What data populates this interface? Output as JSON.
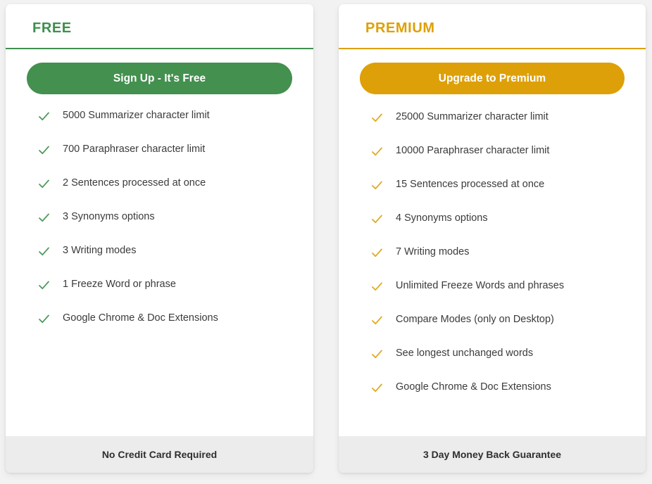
{
  "plans": [
    {
      "id": "free",
      "title": "FREE",
      "accent_color": "#3f8f4f",
      "button_color": "#43904f",
      "cta_label": "Sign Up - It's Free",
      "check_icon": "check-icon",
      "features": [
        "5000 Summarizer character limit",
        "700 Paraphraser character limit",
        "2 Sentences processed at once",
        "3 Synonyms options",
        "3 Writing modes",
        "1 Freeze Word or phrase",
        "Google Chrome & Doc Extensions"
      ],
      "footer_note": "No Credit Card Required"
    },
    {
      "id": "premium",
      "title": "PREMIUM",
      "accent_color": "#dda008",
      "button_color": "#dda008",
      "cta_label": "Upgrade to Premium",
      "check_icon": "check-icon",
      "features": [
        "25000 Summarizer character limit",
        "10000 Paraphraser character limit",
        "15 Sentences processed at once",
        "4 Synonyms options",
        "7 Writing modes",
        "Unlimited Freeze Words and phrases",
        "Compare Modes (only on Desktop)",
        "See longest unchanged words",
        "Google Chrome & Doc Extensions"
      ],
      "footer_note": "3 Day Money Back Guarantee"
    }
  ]
}
